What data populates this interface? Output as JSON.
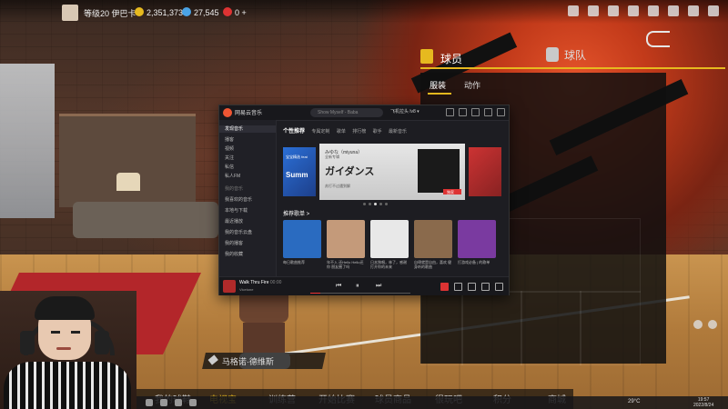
{
  "hud": {
    "level_name": "等级20 伊巴卡",
    "vc": "2,351,373",
    "mt": "27,545",
    "badge_count": "0",
    "plus": "+"
  },
  "right_panel": {
    "tab_player": "球员",
    "tab_team": "球队",
    "subtab_outfit": "服装",
    "subtab_action": "动作"
  },
  "music_app": {
    "app_name": "网易云音乐",
    "search_placeholder": "Show Myself - Baba",
    "user": "飞机拉头 lv8 ▾",
    "sidebar": [
      "发现音乐",
      "播客",
      "视频",
      "关注",
      "私信",
      "私人FM",
      "我的音乐",
      "我喜欢的音乐",
      "本地与下载",
      "最近播放",
      "我的音乐云盘",
      "我的播客",
      "我的收藏"
    ],
    "tabs": [
      "个性推荐",
      "专属定制",
      "歌单",
      "排行榜",
      "歌手",
      "最新音乐"
    ],
    "banner": {
      "side_small": "Summ",
      "side_text": "宝宝精选 feat",
      "artist": "みゆな（miyuna）",
      "subtitle": "全新专辑",
      "title": "ガイダンス",
      "footer": "苏打不过遇到解",
      "badge": "独家"
    },
    "recommend_title": "推荐歌单 >",
    "cards": [
      {
        "caption": "每日歌曲推荐",
        "color": "#2a6bc0"
      },
      {
        "caption": "年不入 还Hello Hello还你 朋友圈了吗",
        "color": "#c49a7a"
      },
      {
        "caption": "日本独唱，林了，感谢打开你的未来",
        "color": "#e8e8e8"
      },
      {
        "caption": "自律就是自由，喜欢 健身听的歌曲",
        "color": "#8a6a4c"
      },
      {
        "caption": "打游戏必备 | 的歌单",
        "color": "#7a3aa0"
      }
    ],
    "player": {
      "song": "Walk Thru Fire",
      "time": "00:00",
      "artist": "Vicetone",
      "prev": "⏮",
      "play": "⏸",
      "next": "⏭"
    }
  },
  "player_name": "马格诺·德维斯",
  "bottom_menu": [
    "我的球鞋",
    "电视宝",
    "训练营",
    "开始比赛",
    "球员商品",
    "很玩吧",
    "积分",
    "商城"
  ],
  "bottom_active_index": 1,
  "taskbar": {
    "temperature": "29°C",
    "time": "19:57",
    "date": "2022/8/24"
  }
}
